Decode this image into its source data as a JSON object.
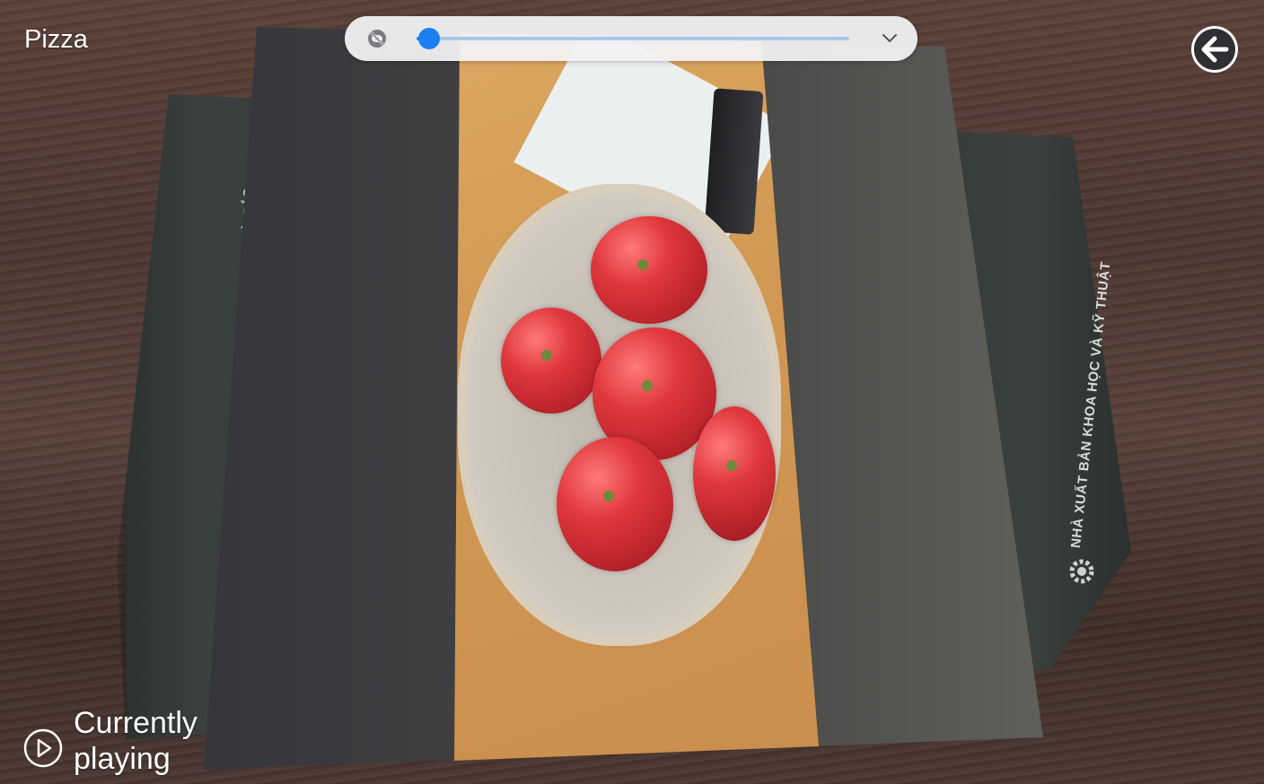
{
  "app": {
    "title": "Pizza"
  },
  "book": {
    "author_text": "LÊ HOÀI BẮC",
    "publisher_text": "NHÀ XUẤT BẢN KHOA HỌC VÀ KỸ THUẬT"
  },
  "player": {
    "status_text": "Currently playing",
    "progress": 0.03,
    "visibility_icon": "visibility-off-icon",
    "expand_icon": "chevron-down-icon"
  },
  "controls": {
    "back_icon": "arrow-left-icon",
    "play_icon": "play-icon"
  },
  "colors": {
    "accent": "#1b7ff2",
    "track": "#a9c8ea",
    "bar_background": "#f2f2f4",
    "overlay_text": "#ffffff"
  }
}
